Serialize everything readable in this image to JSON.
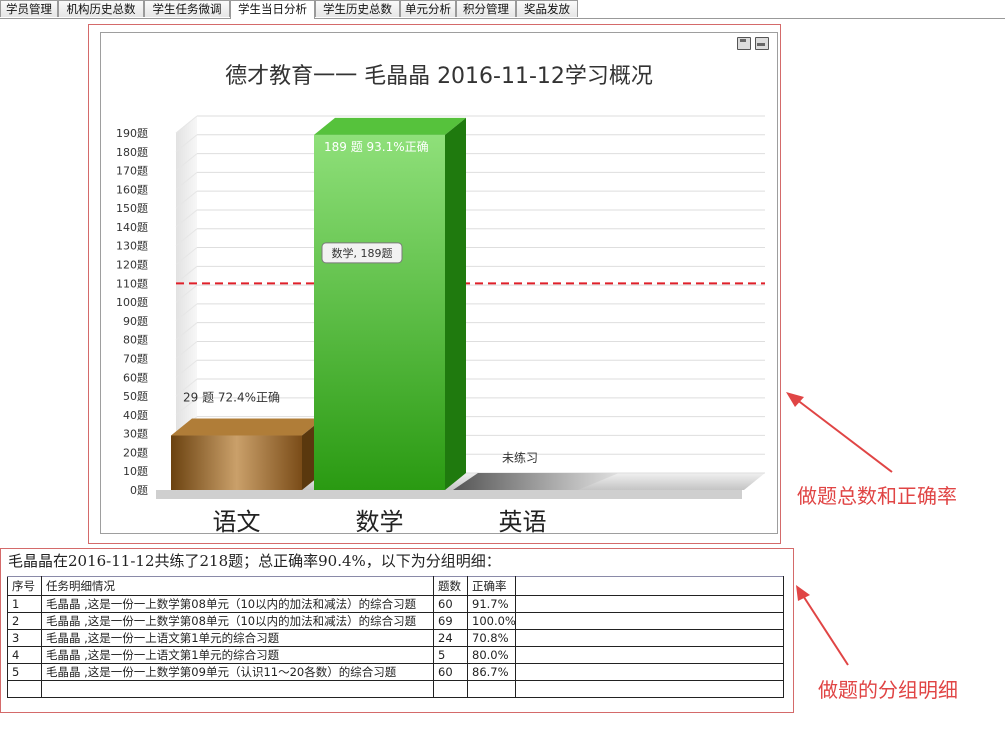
{
  "tabs": [
    {
      "label": "学员管理",
      "active": false
    },
    {
      "label": "机构历史总数",
      "active": false
    },
    {
      "label": "学生任务微调",
      "active": false
    },
    {
      "label": "学生当日分析",
      "active": true
    },
    {
      "label": "学生历史总数",
      "active": false
    },
    {
      "label": "单元分析",
      "active": false
    },
    {
      "label": "积分管理",
      "active": false
    },
    {
      "label": "奖品发放",
      "active": false
    }
  ],
  "chart_data": {
    "type": "bar",
    "title": "德才教育一一 毛晶晶  2016-11-12学习概况",
    "categories": [
      "语文",
      "数学",
      "英语"
    ],
    "values": [
      29,
      189,
      0
    ],
    "data_labels": [
      "29 题  72.4%正确",
      "189 题  93.1%正确",
      "未练习"
    ],
    "ylim": [
      0,
      190
    ],
    "y_tick_step": 10,
    "y_tick_suffix": "题",
    "reference_line": 110,
    "tooltip": "数学, 189题",
    "colors": [
      "#9b6a2a",
      "#3aa62a",
      "#8a8a8a"
    ],
    "reference_color": "#e0202a"
  },
  "annotations": {
    "chart_note": "做题总数和正确率",
    "table_note": "做题的分组明细"
  },
  "summary": "毛晶晶在2016-11-12共练了218题；总正确率90.4%，以下为分组明细：",
  "table": {
    "headers": [
      "序号",
      "任务明细情况",
      "题数",
      "正确率",
      ""
    ],
    "rows": [
      [
        "1",
        "毛晶晶 ,这是一份一上数学第08单元（10以内的加法和减法）的综合习题",
        "60",
        "91.7%",
        ""
      ],
      [
        "2",
        "毛晶晶 ,这是一份一上数学第08单元（10以内的加法和减法）的综合习题",
        "69",
        "100.0%",
        ""
      ],
      [
        "3",
        "毛晶晶 ,这是一份一上语文第1单元的综合习题",
        "24",
        "70.8%",
        ""
      ],
      [
        "4",
        "毛晶晶 ,这是一份一上语文第1单元的综合习题",
        "5",
        "80.0%",
        ""
      ],
      [
        "5",
        "毛晶晶 ,这是一份一上数学第09单元（认识11～20各数）的综合习题",
        "60",
        "86.7%",
        ""
      ],
      [
        "",
        "",
        "",
        "",
        ""
      ]
    ]
  }
}
